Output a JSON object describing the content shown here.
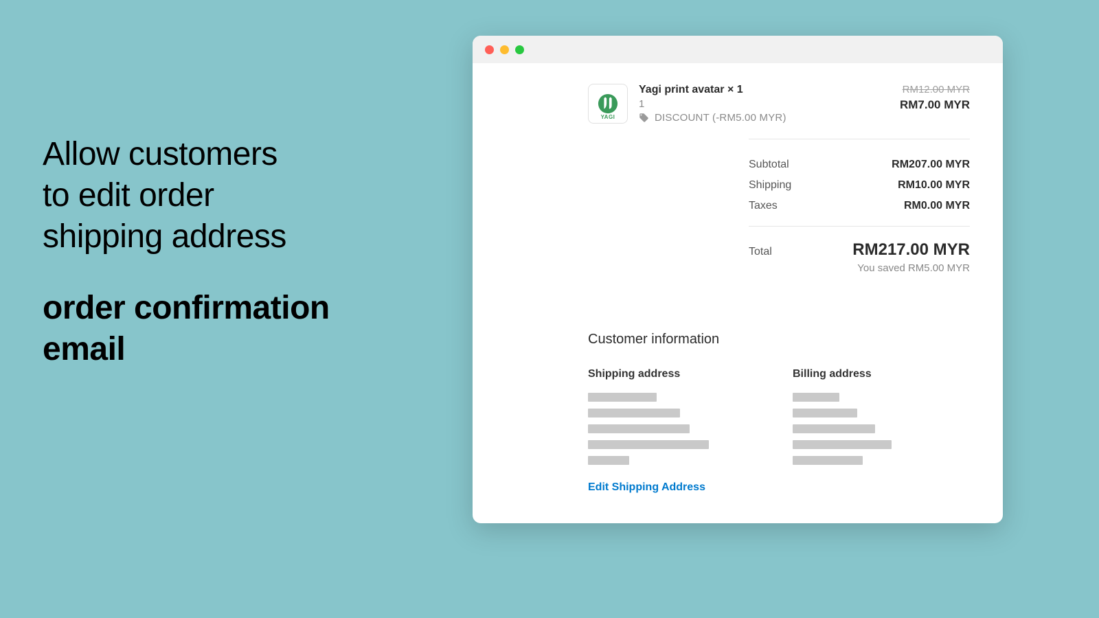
{
  "headline": {
    "line1": "Allow customers",
    "line2": "to edit order",
    "line3": "shipping address",
    "bold1": "order confirmation",
    "bold2": "email"
  },
  "item": {
    "title": "Yagi print avatar × 1",
    "qty": "1",
    "discount_text": "DISCOUNT (-RM5.00 MYR)",
    "price_old": "RM12.00 MYR",
    "price_new": "RM7.00 MYR",
    "thumb_label": "YAGI"
  },
  "totals": {
    "subtotal_label": "Subtotal",
    "subtotal_value": "RM207.00 MYR",
    "shipping_label": "Shipping",
    "shipping_value": "RM10.00 MYR",
    "taxes_label": "Taxes",
    "taxes_value": "RM0.00 MYR",
    "total_label": "Total",
    "total_value": "RM217.00 MYR",
    "savings": "You saved RM5.00 MYR"
  },
  "customer": {
    "heading": "Customer information",
    "shipping_title": "Shipping address",
    "billing_title": "Billing address",
    "edit_link": "Edit Shipping Address"
  }
}
